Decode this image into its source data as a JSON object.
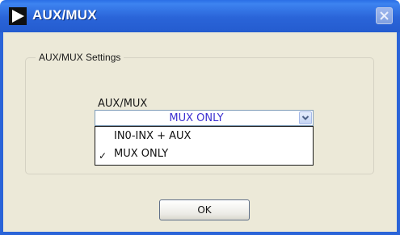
{
  "window": {
    "title": "AUX/MUX",
    "accent_color": "#2a64d8"
  },
  "group": {
    "legend": "AUX/MUX Settings"
  },
  "combo": {
    "label": "AUX/MUX",
    "selected_value": "MUX ONLY",
    "value_color": "#3b2fd0",
    "options": [
      {
        "label": "IN0-INX + AUX",
        "checked": false
      },
      {
        "label": "MUX ONLY",
        "checked": true
      }
    ]
  },
  "buttons": {
    "ok_label": "OK"
  },
  "icons": {
    "app": "play-arrow-icon",
    "close": "close-icon",
    "dropdown": "chevron-down-icon",
    "check": "checkmark-icon"
  }
}
